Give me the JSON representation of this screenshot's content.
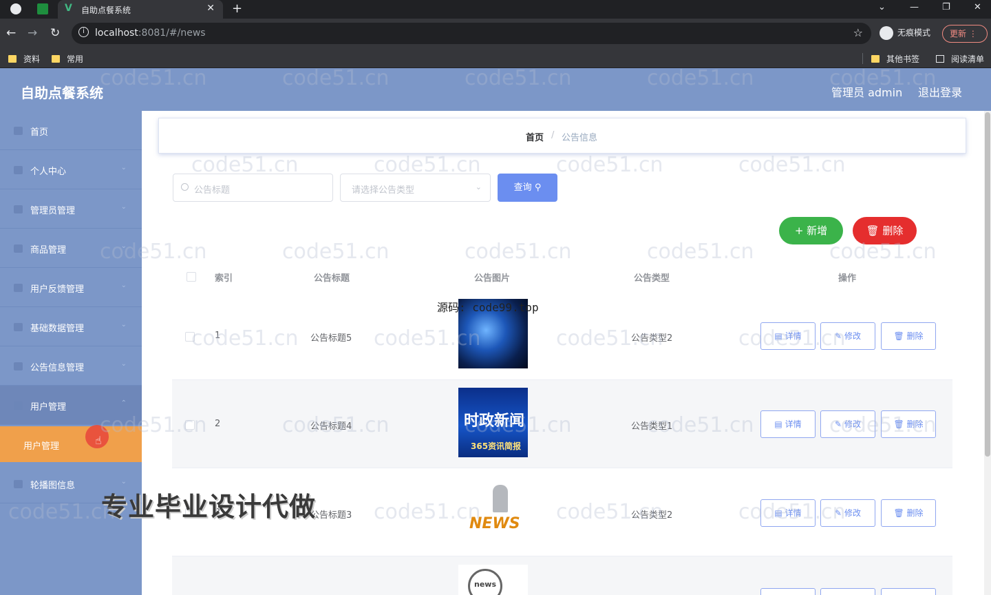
{
  "browser": {
    "tab_title": "自助点餐系统",
    "url_host": "localhost",
    "url_rest": ":8081/#/news",
    "incognito_label": "无痕模式",
    "update_label": "更新",
    "bookmarks": [
      "资料",
      "常用"
    ],
    "bookmarks_right": [
      "其他书签",
      "阅读清单"
    ]
  },
  "header": {
    "title": "自助点餐系统",
    "admin": "管理员 admin",
    "logout": "退出登录"
  },
  "sidebar": {
    "items": [
      {
        "label": "首页"
      },
      {
        "label": "个人中心"
      },
      {
        "label": "管理员管理"
      },
      {
        "label": "商品管理"
      },
      {
        "label": "用户反馈管理"
      },
      {
        "label": "基础数据管理"
      },
      {
        "label": "公告信息管理"
      },
      {
        "label": "用户管理"
      },
      {
        "label": "轮播图信息"
      }
    ],
    "active_sub": "用户管理"
  },
  "breadcrumb": {
    "home": "首页",
    "sep": "/",
    "current": "公告信息"
  },
  "search": {
    "title_placeholder": "公告标题",
    "type_placeholder": "请选择公告类型",
    "query_label": "查询"
  },
  "actions": {
    "add": "新增",
    "delete": "删除"
  },
  "table": {
    "headers": [
      "索引",
      "公告标题",
      "公告图片",
      "公告类型",
      "操作"
    ],
    "rows": [
      {
        "index": "1",
        "title": "公告标题5",
        "type": "公告类型2",
        "image": "globe"
      },
      {
        "index": "2",
        "title": "公告标题4",
        "type": "公告类型1",
        "image": "news-banner"
      },
      {
        "index": "3",
        "title": "公告标题3",
        "type": "公告类型2",
        "image": "news-figure"
      },
      {
        "index": "",
        "title": "",
        "type": "",
        "image": "news-bubble"
      }
    ],
    "ops": {
      "detail": "详情",
      "edit": "修改",
      "remove": "删除"
    }
  },
  "image_text": {
    "banner_big": "时政新闻",
    "banner_small": "365资讯简报",
    "news_word": "NEWS",
    "bubble_word": "news"
  },
  "overlay": {
    "source_text": "源码: code99.top",
    "promo": "专业毕业设计代做",
    "watermark": "code51.cn"
  }
}
